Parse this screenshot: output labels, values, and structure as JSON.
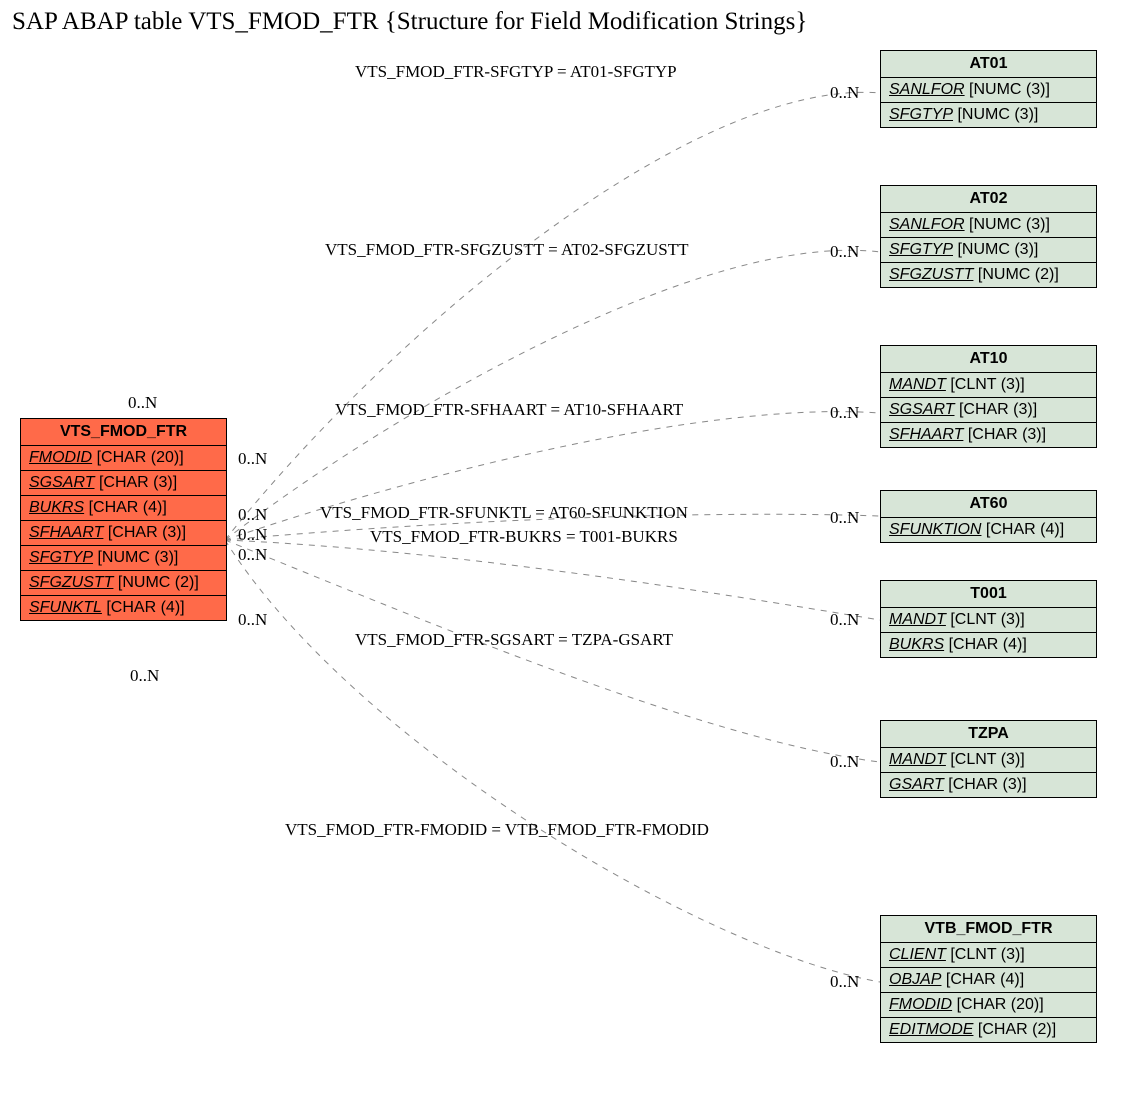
{
  "title": "SAP ABAP table VTS_FMOD_FTR {Structure for Field Modification Strings}",
  "main": {
    "name": "VTS_FMOD_FTR",
    "fields": [
      {
        "n": "FMODID",
        "t": "[CHAR (20)]"
      },
      {
        "n": "SGSART",
        "t": "[CHAR (3)]"
      },
      {
        "n": "BUKRS",
        "t": "[CHAR (4)]"
      },
      {
        "n": "SFHAART",
        "t": "[CHAR (3)]"
      },
      {
        "n": "SFGTYP",
        "t": "[NUMC (3)]"
      },
      {
        "n": "SFGZUSTT",
        "t": "[NUMC (2)]"
      },
      {
        "n": "SFUNKTL",
        "t": "[CHAR (4)]"
      }
    ]
  },
  "refs": {
    "at01": {
      "name": "AT01",
      "fields": [
        {
          "n": "SANLFOR",
          "t": "[NUMC (3)]"
        },
        {
          "n": "SFGTYP",
          "t": "[NUMC (3)]"
        }
      ]
    },
    "at02": {
      "name": "AT02",
      "fields": [
        {
          "n": "SANLFOR",
          "t": "[NUMC (3)]"
        },
        {
          "n": "SFGTYP",
          "t": "[NUMC (3)]"
        },
        {
          "n": "SFGZUSTT",
          "t": "[NUMC (2)]"
        }
      ]
    },
    "at10": {
      "name": "AT10",
      "fields": [
        {
          "n": "MANDT",
          "t": "[CLNT (3)]"
        },
        {
          "n": "SGSART",
          "t": "[CHAR (3)]"
        },
        {
          "n": "SFHAART",
          "t": "[CHAR (3)]"
        }
      ]
    },
    "at60": {
      "name": "AT60",
      "fields": [
        {
          "n": "SFUNKTION",
          "t": "[CHAR (4)]"
        }
      ]
    },
    "t001": {
      "name": "T001",
      "fields": [
        {
          "n": "MANDT",
          "t": "[CLNT (3)]"
        },
        {
          "n": "BUKRS",
          "t": "[CHAR (4)]"
        }
      ]
    },
    "tzpa": {
      "name": "TZPA",
      "fields": [
        {
          "n": "MANDT",
          "t": "[CLNT (3)]"
        },
        {
          "n": "GSART",
          "t": "[CHAR (3)]"
        }
      ]
    },
    "vtb": {
      "name": "VTB_FMOD_FTR",
      "fields": [
        {
          "n": "CLIENT",
          "t": "[CLNT (3)]"
        },
        {
          "n": "OBJAP",
          "t": "[CHAR (4)]"
        },
        {
          "n": "FMODID",
          "t": "[CHAR (20)]"
        },
        {
          "n": "EDITMODE",
          "t": "[CHAR (2)]"
        }
      ]
    }
  },
  "edges": {
    "e1": "VTS_FMOD_FTR-SFGTYP = AT01-SFGTYP",
    "e2": "VTS_FMOD_FTR-SFGZUSTT = AT02-SFGZUSTT",
    "e3": "VTS_FMOD_FTR-SFHAART = AT10-SFHAART",
    "e4": "VTS_FMOD_FTR-SFUNKTL = AT60-SFUNKTION",
    "e5": "VTS_FMOD_FTR-BUKRS = T001-BUKRS",
    "e6": "VTS_FMOD_FTR-SGSART = TZPA-GSART",
    "e7": "VTS_FMOD_FTR-FMODID = VTB_FMOD_FTR-FMODID"
  },
  "card": "0..N"
}
